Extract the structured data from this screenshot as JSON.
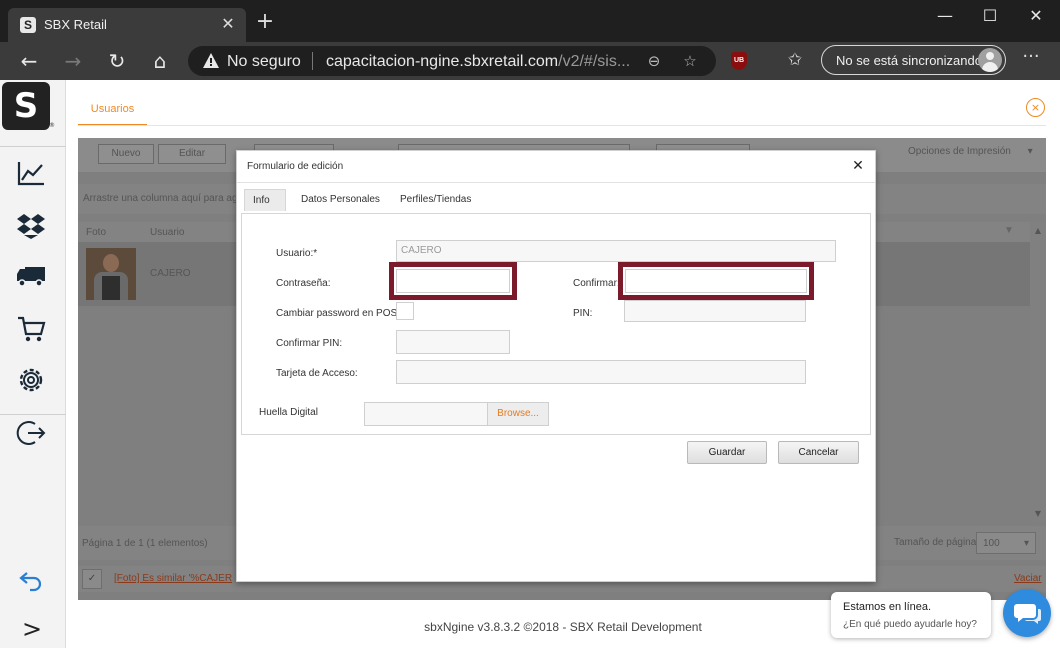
{
  "browser": {
    "tab_title": "SBX Retail",
    "tab_favicon": "S",
    "security_label": "No seguro",
    "url_host": "capacitacion-ngine.sbxretail.com",
    "url_path": "/v2/#/sis...",
    "sync_label": "No se está sincronizando",
    "extension_label": "UB"
  },
  "sidebar": {
    "logo": "S",
    "logo_mark": "®",
    "items": [
      "chart-icon",
      "dropbox-icon",
      "truck-icon",
      "cart-icon",
      "gear-icon",
      "logout-icon"
    ],
    "undo": "undo-icon",
    "expand": ">"
  },
  "page": {
    "tab_label": "Usuarios",
    "close": "×"
  },
  "grid": {
    "toolbar": {
      "new_label": "Nuevo",
      "edit_label": "Editar",
      "print_options": "Opciones de Impresión"
    },
    "drag_hint": "Arrastre una columna aquí para agr",
    "columns": [
      "Foto",
      "Usuario"
    ],
    "rows": [
      {
        "user": "CAJERO"
      }
    ],
    "pager": "Página 1 de 1 (1 elementos)",
    "page_size_label": "Tamaño de página:",
    "page_size": "100",
    "filter_text": "[Foto] Es similar '%CAJER",
    "clear_filter": "Vaciar"
  },
  "footer": "sbxNgine v3.8.3.2 ©2018 - SBX Retail Development",
  "modal": {
    "title": "Formulario de edición",
    "tabs": [
      "Info",
      "Datos Personales",
      "Perfiles/Tiendas"
    ],
    "active_tab": "Info",
    "fields": {
      "usuario_label": "Usuario:*",
      "usuario_value": "CAJERO",
      "password_label": "Contraseña:",
      "confirm_label": "Confirmar:",
      "change_pw_pos_label": "Cambiar password en POS:",
      "pin_label": "PIN:",
      "confirm_pin_label": "Confirmar PIN:",
      "access_card_label": "Tarjeta de Acceso:",
      "fingerprint_label": "Huella Digital",
      "browse_label": "Browse..."
    },
    "save_label": "Guardar",
    "cancel_label": "Cancelar",
    "highlight_color": "#7b1a2a"
  },
  "chat": {
    "line1": "Estamos en línea.",
    "line2": "¿En qué puedo ayudarle hoy?"
  },
  "colors": {
    "accent": "#f08a24",
    "chat": "#2e8bde"
  }
}
